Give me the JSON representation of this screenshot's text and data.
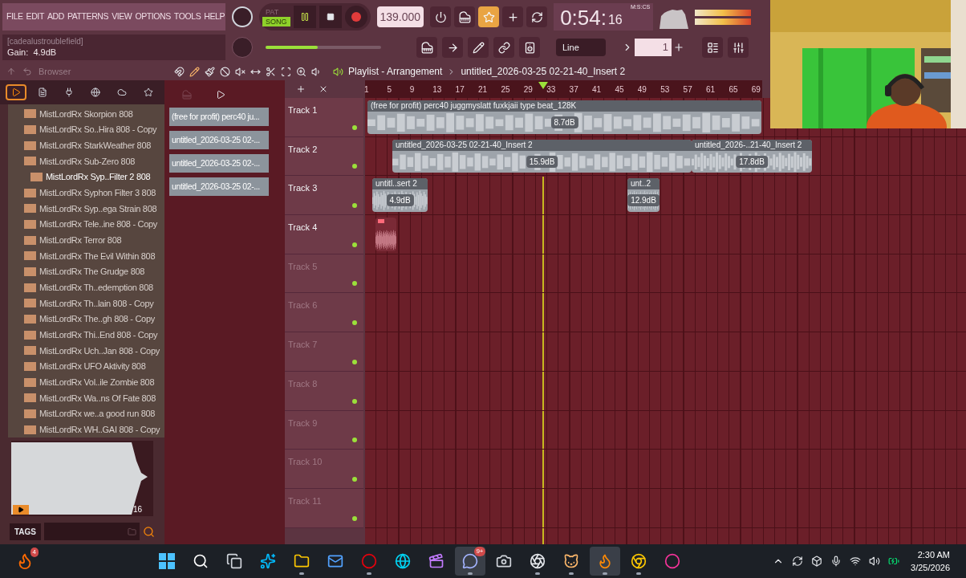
{
  "menu": [
    "FILE",
    "EDIT",
    "ADD",
    "PATTERNS",
    "VIEW",
    "OPTIONS",
    "TOOLS",
    "HELP"
  ],
  "transport": {
    "modes": [
      {
        "label": "PAT",
        "selected": false
      },
      {
        "label": "SONG",
        "selected": true
      }
    ],
    "playing": true
  },
  "tempo": "139.000",
  "time": {
    "main": "0:54:",
    "sub": "16",
    "unit": "M:S:CS"
  },
  "hint": {
    "title": "[cadealustroublefield]",
    "text": "Gain:  4.9dB"
  },
  "master_volume": {
    "level": 0.45
  },
  "snap": "Line",
  "pattern": "1",
  "browser": {
    "title": "Browser",
    "tabs": [
      {
        "kind": "all",
        "selected": true
      },
      {
        "kind": "files",
        "selected": false
      },
      {
        "kind": "plugins",
        "selected": false
      },
      {
        "kind": "web",
        "selected": false
      },
      {
        "kind": "cloud",
        "selected": false
      },
      {
        "kind": "favorites",
        "selected": false
      }
    ],
    "items": [
      {
        "label": "MistLordRx Skorpion 808",
        "selected": false
      },
      {
        "label": "MistLordRx So..Hira 808 - Copy",
        "selected": false
      },
      {
        "label": "MistLordRx StarkWeather 808",
        "selected": false
      },
      {
        "label": "MistLordRx Sub-Zero 808",
        "selected": false
      },
      {
        "label": "MistLordRx Syp..Filter 2 808",
        "selected": true
      },
      {
        "label": "MistLordRx Syphon Filter 3 808",
        "selected": false
      },
      {
        "label": "MistLordRx Syp..ega Strain 808",
        "selected": false
      },
      {
        "label": "MistLordRx Tele..ine 808 - Copy",
        "selected": false
      },
      {
        "label": "MistLordRx Terror 808",
        "selected": false
      },
      {
        "label": "MistLordRx The Evil Within 808",
        "selected": false
      },
      {
        "label": "MistLordRx The Grudge 808",
        "selected": false
      },
      {
        "label": "MistLordRx Th..edemption 808",
        "selected": false
      },
      {
        "label": "MistLordRx Th..lain 808 - Copy",
        "selected": false
      },
      {
        "label": "MistLordRx The..gh 808 - Copy",
        "selected": false
      },
      {
        "label": "MistLordRx Thi..End 808 - Copy",
        "selected": false
      },
      {
        "label": "MistLordRx Uch..Jan 808 - Copy",
        "selected": false
      },
      {
        "label": "MistLordRx UFO Aktivity 808",
        "selected": false
      },
      {
        "label": "MistLordRx Vol..ile Zombie 808",
        "selected": false
      },
      {
        "label": "MistLordRx Wa..ns Of Fate 808",
        "selected": false
      },
      {
        "label": "MistLordRx we..a good run 808",
        "selected": false
      },
      {
        "label": "MistLordRx WH..GAI 808 - Copy",
        "selected": false
      }
    ],
    "preview": {
      "count": "16"
    },
    "tags": "TAGS"
  },
  "picker": [
    "(free for profit) perc40 ju...",
    "untitled_2026-03-25 02-...",
    "untitled_2026-03-25 02-...",
    "untitled_2026-03-25 02-..."
  ],
  "playlist": {
    "title": "Playlist - Arrangement",
    "current": "untitled_2026-03-25 02-21-40_Insert 2",
    "ruler": [
      "1",
      "5",
      "9",
      "13",
      "17",
      "21",
      "25",
      "29",
      "33",
      "37",
      "41",
      "45",
      "49",
      "53",
      "57",
      "61",
      "65",
      "69"
    ],
    "tracks": [
      {
        "name": "Track 1",
        "dimmed": false,
        "clips": [
          {
            "title": "(free for profit) perc40 juggmyslatt fuxkjaii type beat_128K",
            "gain": "8.7dB"
          }
        ]
      },
      {
        "name": "Track 2",
        "dimmed": false,
        "clips": [
          {
            "title": "untitled_2026-03-25 02-21-40_Insert 2",
            "gain": "15.9dB"
          },
          {
            "title": "untitled_2026-..21-40_Insert 2",
            "gain": "17.8dB"
          }
        ]
      },
      {
        "name": "Track 3",
        "dimmed": false,
        "clips": [
          {
            "title": "untitl..sert 2",
            "gain": "4.9dB"
          },
          {
            "title": "unt..2",
            "gain": "12.9dB"
          }
        ]
      },
      {
        "name": "Track 4",
        "dimmed": false,
        "clips": [
          {
            "kind": "untitled"
          }
        ]
      },
      {
        "name": "Track 5",
        "dimmed": true
      },
      {
        "name": "Track 6",
        "dimmed": true
      },
      {
        "name": "Track 7",
        "dimmed": true
      },
      {
        "name": "Track 8",
        "dimmed": true
      },
      {
        "name": "Track 9",
        "dimmed": true
      },
      {
        "name": "Track 10",
        "dimmed": true
      },
      {
        "name": "Track 11",
        "dimmed": true
      }
    ]
  },
  "taskbar": {
    "apps": [
      {
        "kind": "start",
        "active": false,
        "running": false
      },
      {
        "kind": "search",
        "active": false,
        "running": false
      },
      {
        "kind": "taskview",
        "active": false,
        "running": false
      },
      {
        "kind": "copilot",
        "active": false,
        "running": false
      },
      {
        "kind": "explorer",
        "active": false,
        "running": true
      },
      {
        "kind": "mail",
        "active": false,
        "running": false
      },
      {
        "kind": "opera",
        "active": false,
        "running": true
      },
      {
        "kind": "edge",
        "active": false,
        "running": false
      },
      {
        "kind": "video",
        "active": false,
        "running": false
      },
      {
        "kind": "chat",
        "active": true,
        "running": true,
        "badge": "9+"
      },
      {
        "kind": "camera",
        "active": false,
        "running": false
      },
      {
        "kind": "obs",
        "active": false,
        "running": true
      },
      {
        "kind": "animal",
        "active": false,
        "running": true
      },
      {
        "kind": "fl",
        "active": true,
        "running": true
      },
      {
        "kind": "chrome",
        "active": false,
        "running": true
      },
      {
        "kind": "operagx",
        "active": false,
        "running": false
      }
    ],
    "widget_badge": "4",
    "time": "2:30 AM",
    "date": "3/25/2026"
  }
}
